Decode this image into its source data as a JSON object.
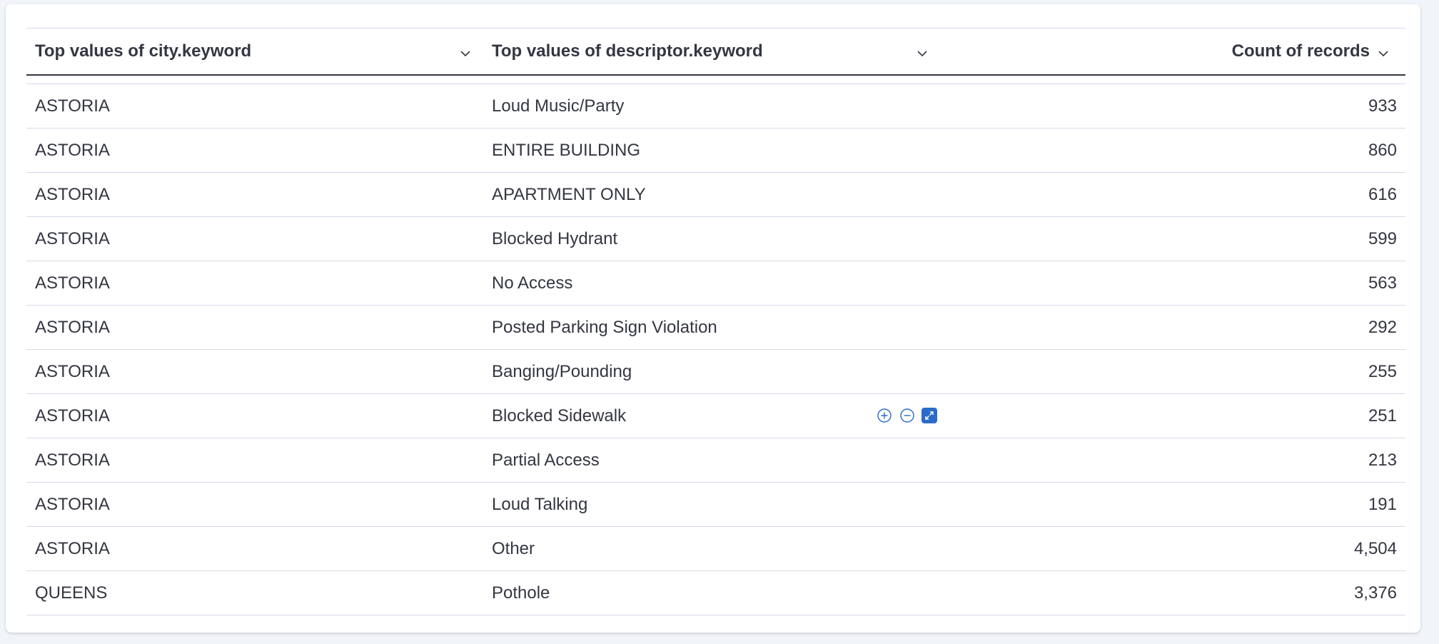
{
  "table": {
    "columns": [
      {
        "label": "Top values of city.keyword"
      },
      {
        "label": "Top values of descriptor.keyword"
      },
      {
        "label": "Count of records"
      }
    ],
    "rows": [
      {
        "city": "ASTORIA",
        "descriptor": "Loud Music/Party",
        "count": "933"
      },
      {
        "city": "ASTORIA",
        "descriptor": "ENTIRE BUILDING",
        "count": "860"
      },
      {
        "city": "ASTORIA",
        "descriptor": "APARTMENT ONLY",
        "count": "616"
      },
      {
        "city": "ASTORIA",
        "descriptor": "Blocked Hydrant",
        "count": "599"
      },
      {
        "city": "ASTORIA",
        "descriptor": "No Access",
        "count": "563"
      },
      {
        "city": "ASTORIA",
        "descriptor": "Posted Parking Sign Violation",
        "count": "292"
      },
      {
        "city": "ASTORIA",
        "descriptor": "Banging/Pounding",
        "count": "255"
      },
      {
        "city": "ASTORIA",
        "descriptor": "Blocked Sidewalk",
        "count": "251"
      },
      {
        "city": "ASTORIA",
        "descriptor": "Partial Access",
        "count": "213"
      },
      {
        "city": "ASTORIA",
        "descriptor": "Loud Talking",
        "count": "191"
      },
      {
        "city": "ASTORIA",
        "descriptor": "Other",
        "count": "4,504"
      },
      {
        "city": "QUEENS",
        "descriptor": "Pothole",
        "count": "3,376"
      }
    ],
    "hovered_cell_actions": [
      "plus-circle-icon",
      "minus-circle-icon",
      "expand-icon"
    ]
  },
  "colors": {
    "accent": "#2b6bc9",
    "text": "#343741",
    "border": "#d3dae6",
    "background": "#f1f4f8"
  }
}
